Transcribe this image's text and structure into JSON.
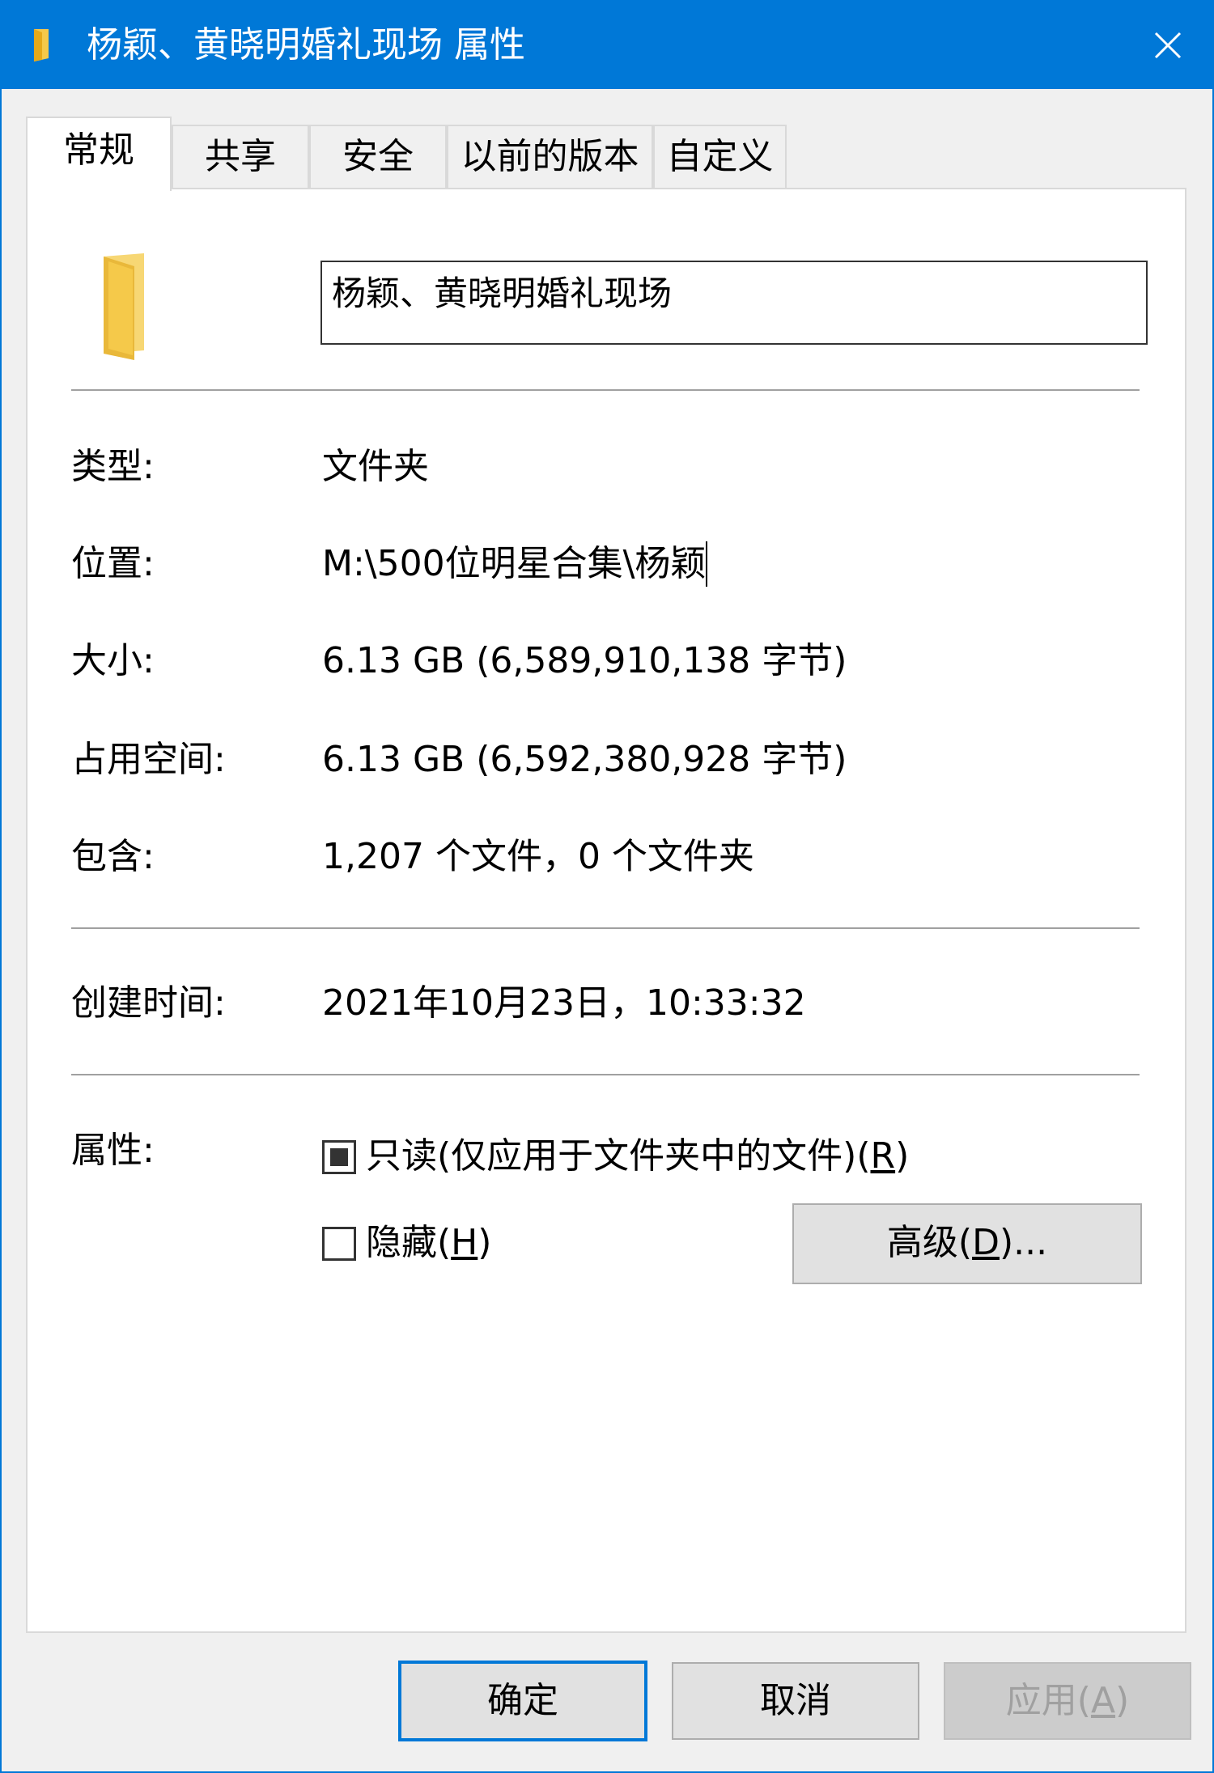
{
  "window": {
    "title": "杨颖、黄晓明婚礼现场 属性",
    "title_icon": "folder-icon",
    "close_icon": "close-icon"
  },
  "tabs": [
    {
      "label": "常规",
      "active": true
    },
    {
      "label": "共享",
      "active": false
    },
    {
      "label": "安全",
      "active": false
    },
    {
      "label": "以前的版本",
      "active": false
    },
    {
      "label": "自定义",
      "active": false
    }
  ],
  "general": {
    "folder_name": "杨颖、黄晓明婚礼现场",
    "type_label": "类型:",
    "type_value": "文件夹",
    "location_label": "位置:",
    "location_value": "M:\\500位明星合集\\杨颖",
    "size_label": "大小:",
    "size_value": "6.13 GB (6,589,910,138 字节)",
    "disk_size_label": "占用空间:",
    "disk_size_value": "6.13 GB (6,592,380,928 字节)",
    "contains_label": "包含:",
    "contains_value": "1,207 个文件，0 个文件夹",
    "created_label": "创建时间:",
    "created_value": "2021年10月23日，10:33:32",
    "attributes_label": "属性:",
    "readonly_label": "只读(仅应用于文件夹中的文件)(",
    "readonly_key": "R",
    "readonly_checked": "indeterminate",
    "hidden_label": "隐藏(",
    "hidden_key": "H",
    "hidden_checked": false,
    "advanced_label": "高级(",
    "advanced_key": "D",
    "advanced_suffix": ")..."
  },
  "footer": {
    "ok_label": "确定",
    "cancel_label": "取消",
    "apply_label": "应用(",
    "apply_key": "A",
    "apply_enabled": false
  },
  "colors": {
    "accent": "#0078d7",
    "folder": "#f5c94a"
  }
}
